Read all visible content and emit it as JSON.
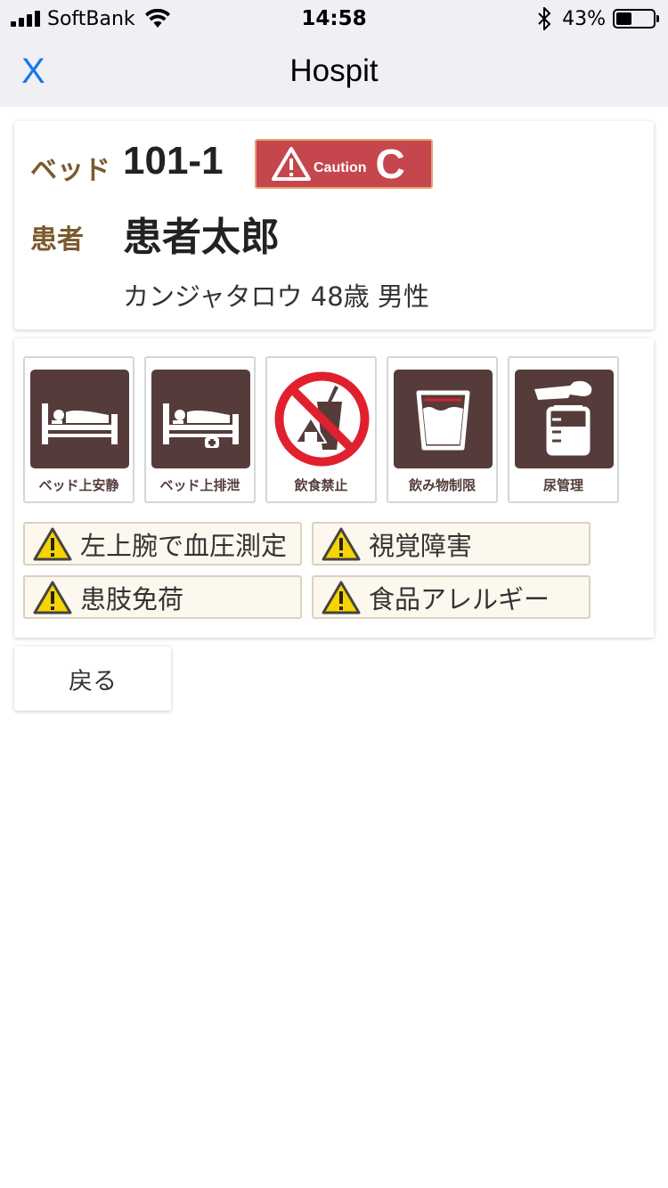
{
  "status_bar": {
    "carrier": "SoftBank",
    "time": "14:58",
    "battery_percent": "43%",
    "battery_level": 0.43,
    "icons": [
      "signal-icon",
      "wifi-icon",
      "bluetooth-icon",
      "battery-icon"
    ]
  },
  "nav": {
    "close_label": "X",
    "title": "Hospit"
  },
  "patient": {
    "bed_label": "ベッド",
    "bed_number": "101-1",
    "caution": {
      "text": "Caution",
      "level": "C",
      "color": "#c5464d",
      "icon": "warning-triangle-icon"
    },
    "patient_label": "患者",
    "name": "患者太郎",
    "kana_age_sex": "カンジャタロウ 48歳 男性"
  },
  "care_icons": [
    {
      "label": "ベッド上安静",
      "icon": "bed-rest-icon"
    },
    {
      "label": "ベッド上排泄",
      "icon": "bed-excretion-icon"
    },
    {
      "label": "飲食禁止",
      "icon": "no-eating-drinking-icon"
    },
    {
      "label": "飲み物制限",
      "icon": "fluid-restriction-icon"
    },
    {
      "label": "尿管理",
      "icon": "urine-management-icon"
    }
  ],
  "warnings": [
    {
      "text": "左上腕で血圧測定",
      "icon": "warning-icon"
    },
    {
      "text": "視覚障害",
      "icon": "warning-icon"
    },
    {
      "text": "患肢免荷",
      "icon": "warning-icon"
    },
    {
      "text": "食品アレルギー",
      "icon": "warning-icon"
    }
  ],
  "back_button": "戻る",
  "colors": {
    "accent": "#1478ef",
    "label_brown": "#7b5a2e",
    "icon_brown": "#553c3a",
    "warning_yellow": "#f7d400",
    "prohibit_red": "#e0202e"
  }
}
